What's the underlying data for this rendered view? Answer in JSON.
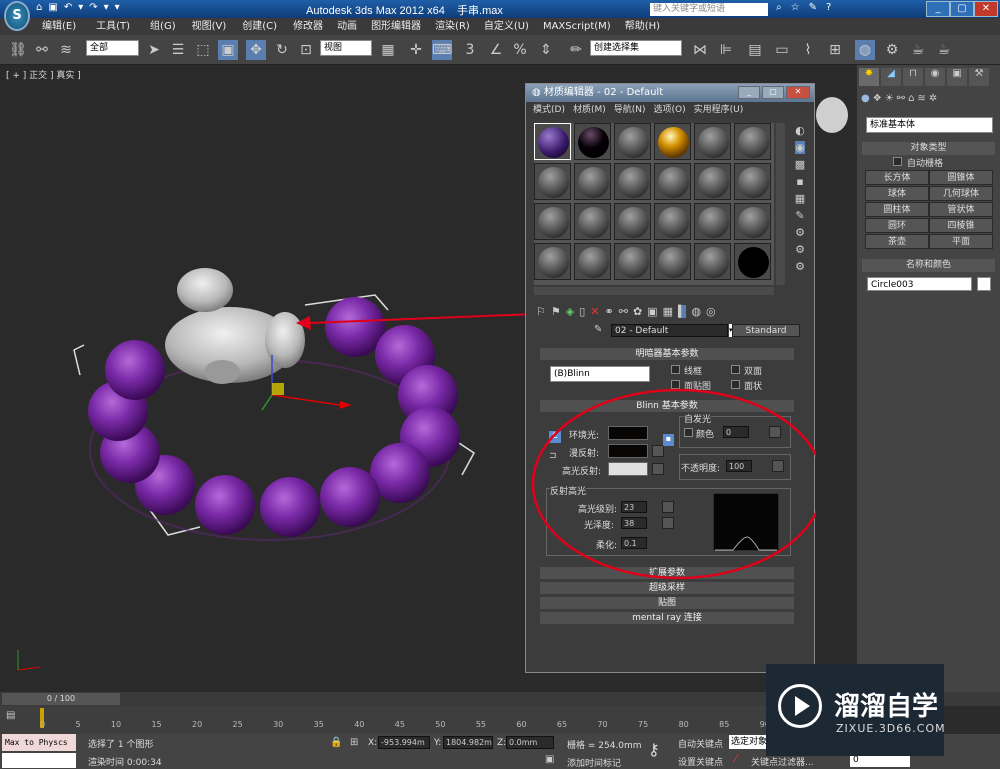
{
  "app": {
    "title": "Autodesk 3ds Max  2012 x64",
    "filename": "手串.max",
    "search_placeholder": "键入关键字或短语",
    "logo": "S"
  },
  "quick_access": [
    "⌂",
    "▣",
    "↶",
    "▾",
    "↷",
    "▾",
    "▾"
  ],
  "menu": [
    "编辑(E)",
    "工具(T)",
    "组(G)",
    "视图(V)",
    "创建(C)",
    "修改器",
    "动画",
    "图形编辑器",
    "渲染(R)",
    "自定义(U)",
    "MAXScript(M)",
    "帮助(H)"
  ],
  "toolbar": {
    "selection_filter": "全部",
    "ref_coord": "视图",
    "named_sel": "创建选择集"
  },
  "viewport": {
    "label": "[ + ] 正交 ] 真实 ]"
  },
  "material_editor": {
    "title": "材质编辑器 - 02 - Default",
    "menu": [
      "模式(D)",
      "材质(M)",
      "导航(N)",
      "选项(O)",
      "实用程序(U)"
    ],
    "material_name": "02 - Default",
    "material_type": "Standard",
    "shader_rollout": "明暗器基本参数",
    "shader": "(B)Blinn",
    "opt_wire": "线框",
    "opt_2sided": "双面",
    "opt_facemap": "面贴图",
    "opt_faceted": "面状",
    "blinn_rollout": "Blinn 基本参数",
    "self_illum": "自发光",
    "color_label": "颜色",
    "self_illum_value": "0",
    "ambient": "环境光:",
    "diffuse": "漫反射:",
    "specular": "高光反射:",
    "opacity_label": "不透明度:",
    "opacity_value": "100",
    "spec_highlights": "反射高光",
    "spec_level_label": "高光级别:",
    "spec_level": "23",
    "gloss_label": "光泽度:",
    "gloss": "38",
    "soften_label": "柔化:",
    "soften": "0.1",
    "ext_params": "扩展参数",
    "supersample": "超级采样",
    "maps": "贴图",
    "mental_ray": "mental ray 连接"
  },
  "cmd_panel": {
    "dropdown": "标准基本体",
    "obj_type": "对象类型",
    "autogrid": "自动栅格",
    "buttons": [
      "长方体",
      "圆锥体",
      "球体",
      "几何球体",
      "圆柱体",
      "管状体",
      "圆环",
      "四棱锥",
      "茶壶",
      "平面"
    ],
    "name_color": "名称和颜色",
    "object_name": "Circle003"
  },
  "timeline": {
    "frame": "0 / 100",
    "ticks": [
      "0",
      "5",
      "10",
      "15",
      "20",
      "25",
      "30",
      "35",
      "40",
      "45",
      "50",
      "55",
      "60",
      "65",
      "70",
      "75",
      "80",
      "85",
      "90"
    ]
  },
  "status": {
    "script": "Max to Physcs",
    "selected": "选择了 1 个图形",
    "render_time": "渲染时间  0:00:34",
    "x_label": "X:",
    "x": "-953.994m",
    "y_label": "Y:",
    "y": "1804.982m",
    "z_label": "Z:",
    "z": "0.0mm",
    "grid": "栅格 = 254.0mm",
    "add_tag": "添加时间标记",
    "autokey": "自动关键点",
    "setkey": "设置关键点",
    "sel_obj": "选定对象",
    "key_filter": "关键点过滤器...",
    "frame_field": "0"
  },
  "watermark": {
    "brand": "溜溜自学",
    "url": "ZIXUE.3D66.COM"
  }
}
